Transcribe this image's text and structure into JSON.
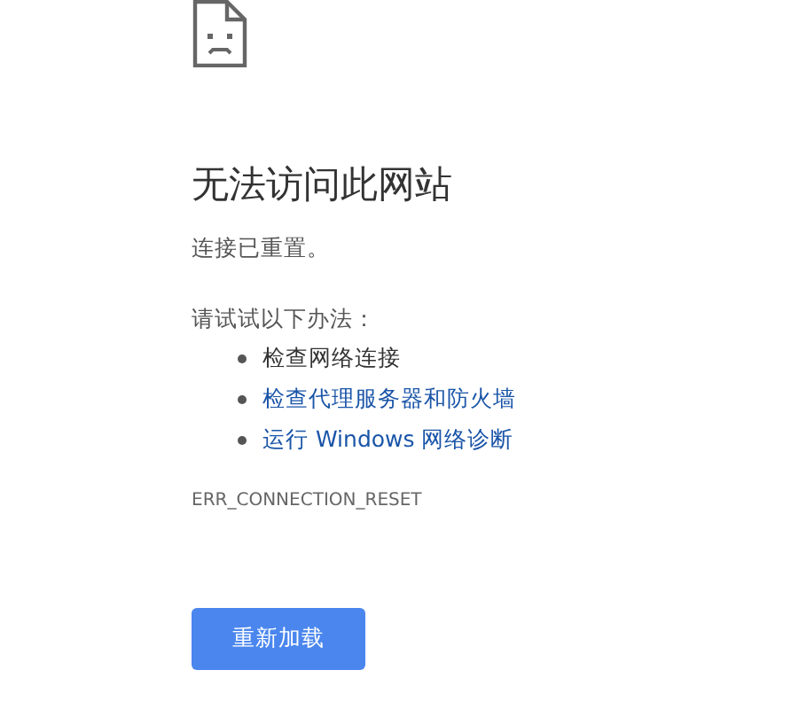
{
  "heading": "无法访问此网站",
  "message": "连接已重置。",
  "suggestions_intro": "请试试以下办法：",
  "suggestions": [
    {
      "text": "检查网络连接",
      "kind": "text"
    },
    {
      "text": "检查代理服务器和防火墙",
      "kind": "link"
    },
    {
      "text": "运行 Windows 网络诊断",
      "kind": "link"
    }
  ],
  "error_code": "ERR_CONNECTION_RESET",
  "reload_button": "重新加载"
}
